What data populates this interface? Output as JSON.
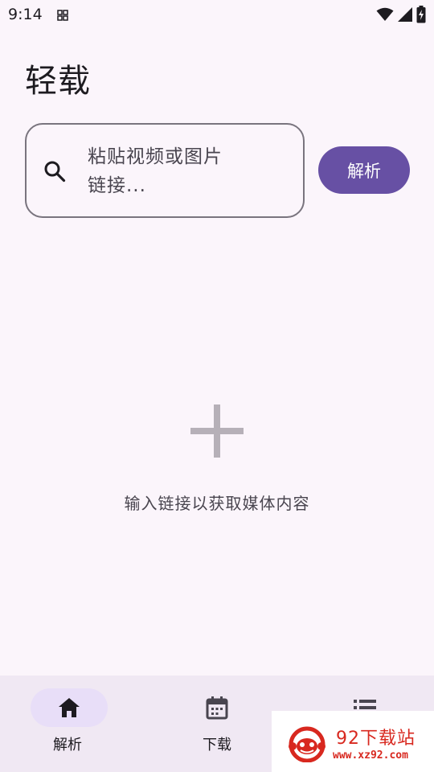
{
  "status_bar": {
    "time": "9:14",
    "icons": [
      "app-notification-icon",
      "wifi-icon",
      "cellular-signal-icon",
      "battery-charging-icon"
    ]
  },
  "app": {
    "title": "轻载"
  },
  "search": {
    "placeholder": "粘贴视频或图片链接...",
    "placeholder_line1": "粘贴视频或图片",
    "placeholder_line2": "链接...",
    "icon": "search-icon"
  },
  "parse_button": {
    "label": "解析"
  },
  "empty_state": {
    "icon": "plus-icon",
    "message": "输入链接以获取媒体内容"
  },
  "bottom_nav": {
    "items": [
      {
        "label": "解析",
        "icon": "home-icon",
        "active": true
      },
      {
        "label": "下载",
        "icon": "calendar-icon",
        "active": false
      },
      {
        "label": "",
        "icon": "list-icon",
        "active": false
      }
    ]
  },
  "watermark": {
    "title": "92下载站",
    "url": "www.xz92.com"
  },
  "colors": {
    "background": "#fbf5fb",
    "primary": "#6750a4",
    "outline": "#79747e",
    "nav_background": "#f0e8f3",
    "nav_indicator": "#e8def8",
    "watermark_red": "#d8281f"
  }
}
